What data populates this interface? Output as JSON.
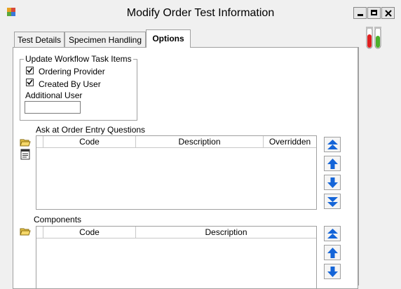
{
  "window": {
    "title": "Modify Order Test Information"
  },
  "tabs": [
    {
      "label": "Test Details"
    },
    {
      "label": "Specimen Handling"
    },
    {
      "label": "Options",
      "active": true
    }
  ],
  "workflow": {
    "group_label": "Update Workflow Task Items",
    "checkboxes": [
      {
        "label": "Ordering Provider",
        "checked": true
      },
      {
        "label": "Created By User",
        "checked": true
      }
    ],
    "additional_user_label": "Additional User",
    "additional_user_value": ""
  },
  "questions": {
    "label": "Ask at Order Entry Questions",
    "columns": [
      "Code",
      "Description",
      "Overridden"
    ],
    "rows": []
  },
  "components": {
    "label": "Components",
    "columns": [
      "Code",
      "Description"
    ],
    "rows": []
  },
  "icons": {
    "open": "folder-open-icon",
    "details": "details-icon",
    "move_top": "double-up-arrow-icon",
    "move_up": "up-arrow-icon",
    "move_down": "down-arrow-icon",
    "move_bottom": "double-down-arrow-icon",
    "app": "app-icon",
    "tubes": "test-tubes-icon"
  },
  "colors": {
    "arrow": "#1565d8",
    "tube_red": "#e02020",
    "tube_green": "#4caf2c"
  }
}
